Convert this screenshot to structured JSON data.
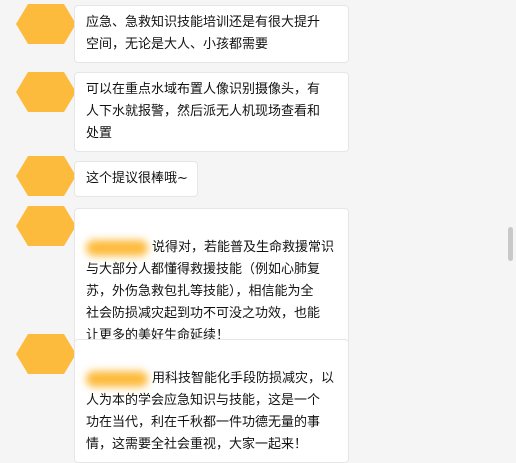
{
  "messages": [
    {
      "text": "应急、急救知识技能培训还是有很大提升\n空间，无论是大人、小孩都需要"
    },
    {
      "text": "可以在重点水域布置人像识别摄像头，有\n人下水就报警，然后派无人机现场查看和\n处置"
    },
    {
      "text": "这个提议很棒哦~"
    },
    {
      "text": "说得对，若能普及生命救援常识\n与大部分人都懂得救援技能（例如心肺复\n苏，外伤急救包扎等技能），相信能为全\n社会防损减灾起到功不可没之功效，也能\n让更多的美好生命延续！"
    },
    {
      "text": "用科技智能化手段防损减灾，以\n人为本的学会应急知识与技能，这是一个\n功在当代，利在千秋都一件功德无量的事\n情，这需要全社会重视，大家一起来！"
    }
  ],
  "colors": {
    "avatar": "#fdbb3d",
    "background": "#f5f5f5",
    "bubble": "#ffffff"
  }
}
